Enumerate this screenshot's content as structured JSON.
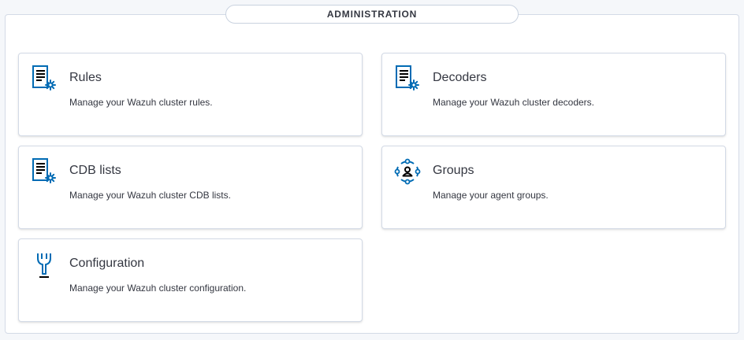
{
  "section": {
    "title": "ADMINISTRATION"
  },
  "cards": [
    {
      "title": "Rules",
      "description": "Manage your Wazuh cluster rules.",
      "icon": "document-gear-icon"
    },
    {
      "title": "Decoders",
      "description": "Manage your Wazuh cluster decoders.",
      "icon": "document-gear-icon"
    },
    {
      "title": "CDB lists",
      "description": "Manage your Wazuh cluster CDB lists.",
      "icon": "document-gear-icon"
    },
    {
      "title": "Groups",
      "description": "Manage your agent groups.",
      "icon": "user-group-icon"
    },
    {
      "title": "Configuration",
      "description": "Manage your Wazuh cluster configuration.",
      "icon": "wrench-icon"
    }
  ],
  "colors": {
    "accent": "#006bb4",
    "text": "#343741",
    "border": "#d3dae6",
    "background": "#f5f7fa"
  }
}
